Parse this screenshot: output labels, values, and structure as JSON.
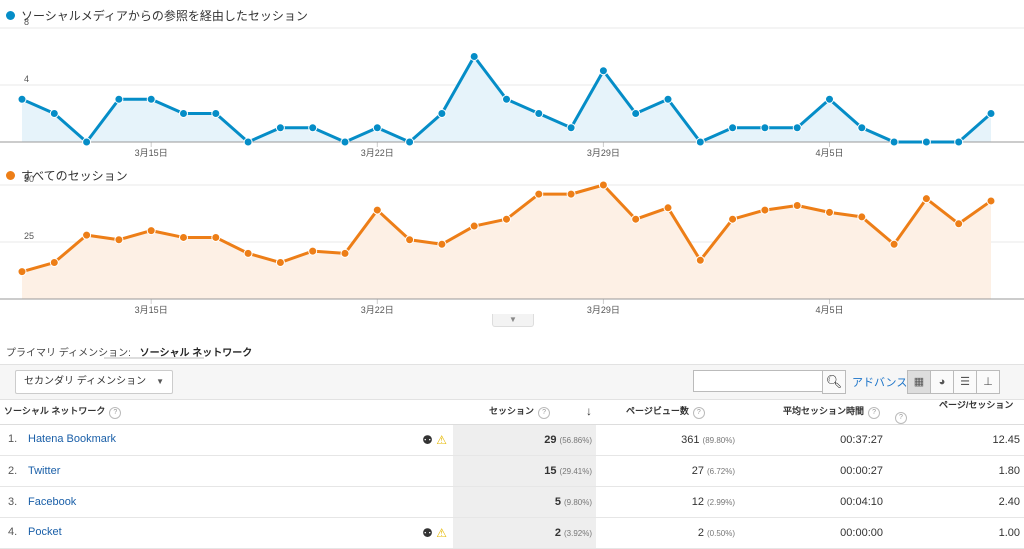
{
  "chart1": {
    "legend": "ソーシャルメディアからの参照を経由したセッション",
    "color": "#058dc7",
    "fill": "#e6f3fa",
    "ymax": 8,
    "ymid_label": "4",
    "ymax_label": "8",
    "values": [
      3,
      2,
      0,
      3,
      3,
      2,
      2,
      0,
      1,
      1,
      0,
      1,
      0,
      2,
      6,
      3,
      2,
      1,
      5,
      2,
      3,
      0,
      1,
      1,
      1,
      3,
      1,
      0,
      0,
      0,
      2
    ]
  },
  "chart2": {
    "legend": "すべてのセッション",
    "color": "#ed7e17",
    "fill": "#fdf0e5",
    "ymax": 50,
    "ymid_label": "25",
    "ymax_label": "50",
    "values": [
      12,
      16,
      28,
      26,
      30,
      27,
      27,
      20,
      16,
      21,
      20,
      39,
      26,
      24,
      32,
      35,
      46,
      46,
      50,
      35,
      40,
      17,
      35,
      39,
      41,
      38,
      36,
      24,
      44,
      33,
      43
    ]
  },
  "xaxis": [
    "3月15日",
    "3月22日",
    "3月29日",
    "4月5日"
  ],
  "primary_dimension": {
    "label": "プライマリ ディメンション:",
    "active": "ソーシャル ネットワーク"
  },
  "toolbar": {
    "secondary_dim": "セカンダリ ディメンション",
    "search_placeholder": "",
    "advance": "アドバンス"
  },
  "table": {
    "headers": {
      "network": "ソーシャル ネットワーク",
      "sessions": "セッション",
      "pageviews": "ページビュー数",
      "avg_time": "平均セッション時間",
      "pages_per": "ページ/セッション"
    },
    "rows": [
      {
        "idx": "1.",
        "name": "Hatena Bookmark",
        "sessions": "29",
        "sessions_pct": "(56.86%)",
        "pv": "361",
        "pv_pct": "(89.80%)",
        "time": "00:37:27",
        "pps": "12.45",
        "icons": true
      },
      {
        "idx": "2.",
        "name": "Twitter",
        "sessions": "15",
        "sessions_pct": "(29.41%)",
        "pv": "27",
        "pv_pct": "(6.72%)",
        "time": "00:00:27",
        "pps": "1.80",
        "icons": false
      },
      {
        "idx": "3.",
        "name": "Facebook",
        "sessions": "5",
        "sessions_pct": "(9.80%)",
        "pv": "12",
        "pv_pct": "(2.99%)",
        "time": "00:04:10",
        "pps": "2.40",
        "icons": false
      },
      {
        "idx": "4.",
        "name": "Pocket",
        "sessions": "2",
        "sessions_pct": "(3.92%)",
        "pv": "2",
        "pv_pct": "(0.50%)",
        "time": "00:00:00",
        "pps": "1.00",
        "icons": true
      }
    ]
  },
  "chart_data": [
    {
      "type": "area",
      "title": "ソーシャルメディアからの参照を経由したセッション",
      "x": [
        "3月15日",
        "3月22日",
        "3月29日",
        "4月5日"
      ],
      "ylim": [
        0,
        8
      ],
      "series": [
        {
          "name": "ソーシャルメディアからの参照を経由したセッション",
          "values": [
            3,
            2,
            0,
            3,
            3,
            2,
            2,
            0,
            1,
            1,
            0,
            1,
            0,
            2,
            6,
            3,
            2,
            1,
            5,
            2,
            3,
            0,
            1,
            1,
            1,
            3,
            1,
            0,
            0,
            0,
            2
          ]
        }
      ]
    },
    {
      "type": "area",
      "title": "すべてのセッション",
      "x": [
        "3月15日",
        "3月22日",
        "3月29日",
        "4月5日"
      ],
      "ylim": [
        0,
        50
      ],
      "series": [
        {
          "name": "すべてのセッション",
          "values": [
            12,
            16,
            28,
            26,
            30,
            27,
            27,
            20,
            16,
            21,
            20,
            39,
            26,
            24,
            32,
            35,
            46,
            46,
            50,
            35,
            40,
            17,
            35,
            39,
            41,
            38,
            36,
            24,
            44,
            33,
            43
          ]
        }
      ]
    }
  ]
}
